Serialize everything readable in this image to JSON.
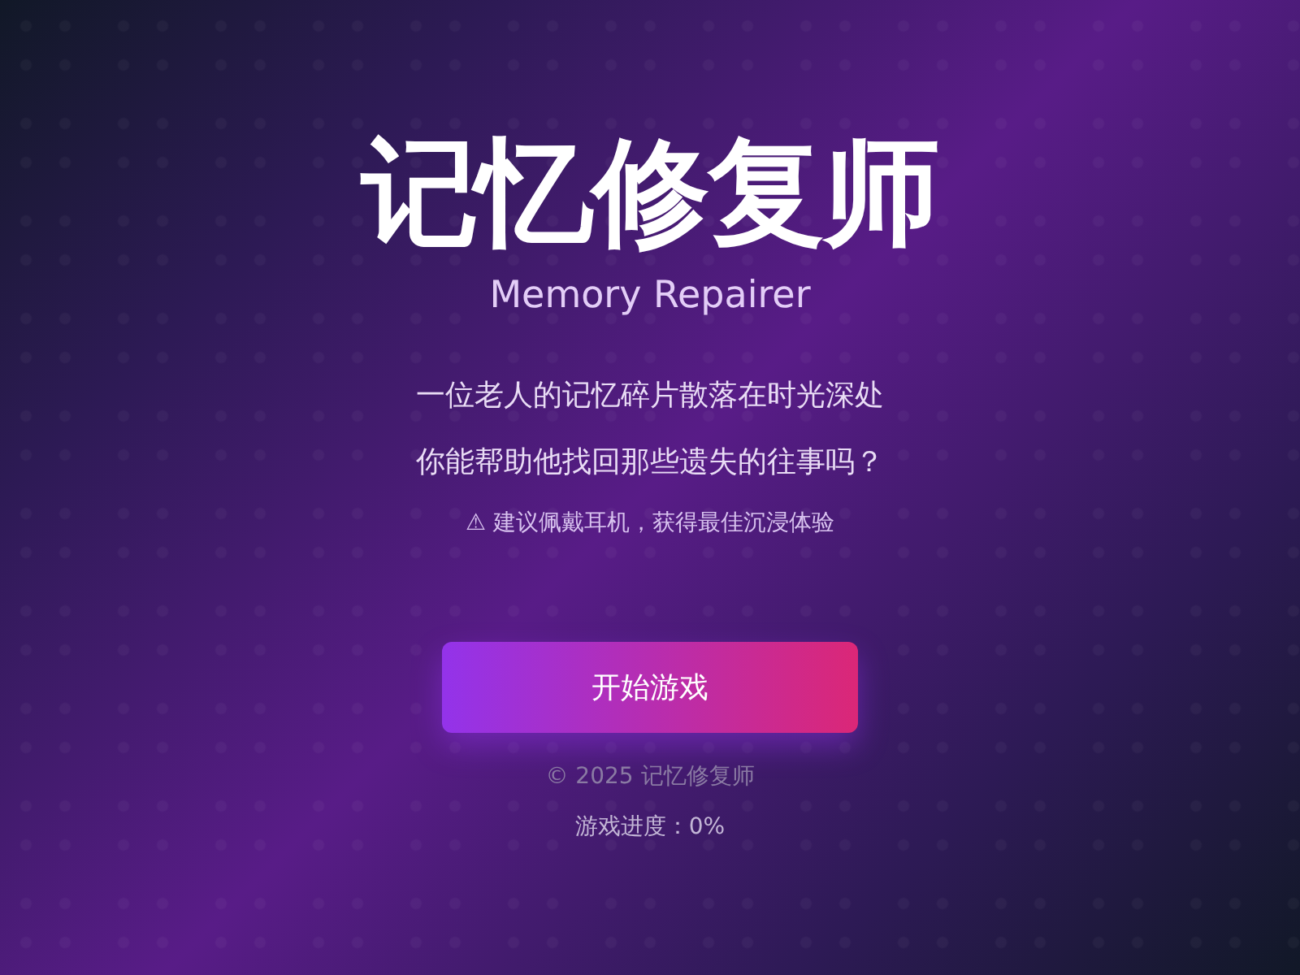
{
  "title": "记忆修复师",
  "subtitle": "Memory Repairer",
  "intro_lines": [
    "一位老人的记忆碎片散落在时光深处",
    "你能帮助他找回那些遗失的往事吗？"
  ],
  "hint": "⚠ 建议佩戴耳机，获得最佳沉浸体验",
  "start_button": {
    "label": "开始游戏"
  },
  "copyright": "© 2025 记忆修复师",
  "progress": "游戏进度：0%"
}
